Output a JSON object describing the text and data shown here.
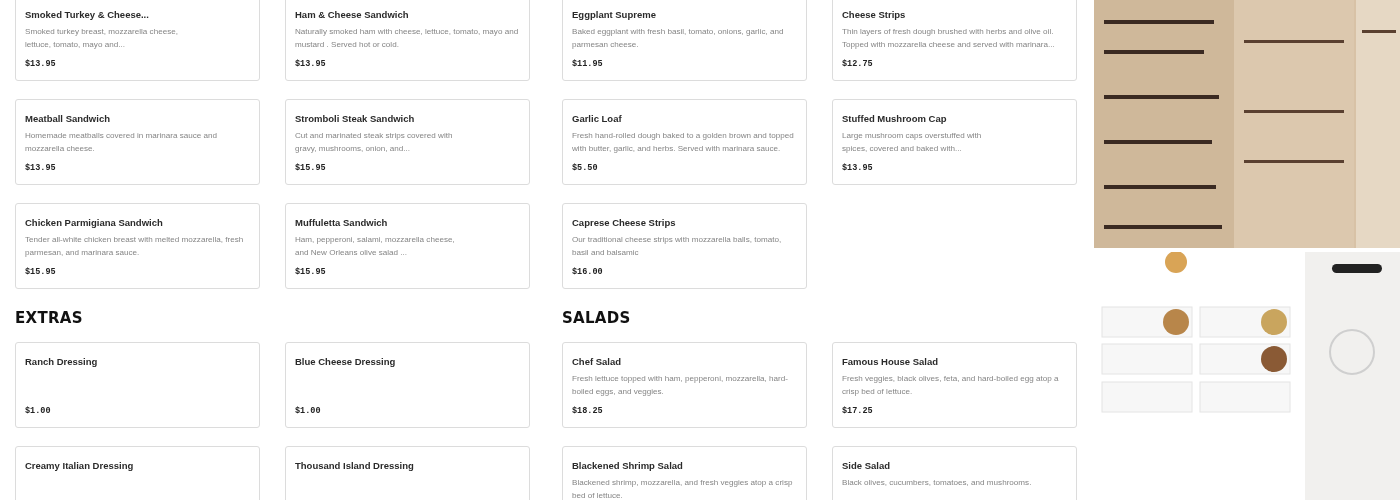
{
  "columns": [
    {
      "sections": [
        {
          "items": [
            {
              "name": "Smoked Turkey & Cheese...",
              "description": "Smoked turkey breast, mozzarella cheese, lettuce, tomato, mayo and...",
              "price": "$13.95",
              "narrow": true
            },
            {
              "name": "Ham & Cheese Sandwich",
              "description": "Naturally smoked ham with cheese, lettuce, tomato, mayo and mustard . Served hot or cold.",
              "price": "$13.95"
            },
            {
              "name": "Meatball Sandwich",
              "description": "Homemade meatballs covered in marinara sauce and mozzarella cheese.",
              "price": "$13.95"
            },
            {
              "name": "Stromboli Steak Sandwich",
              "description": "Cut and marinated steak strips covered with gravy, mushrooms, onion, and...",
              "price": "$15.95",
              "narrow": true
            },
            {
              "name": "Chicken Parmigiana Sandwich",
              "description": "Tender all-white chicken breast with melted mozzarella, fresh parmesan, and marinara sauce.",
              "price": "$15.95"
            },
            {
              "name": "Muffuletta Sandwich",
              "description": "Ham, pepperoni, salami, mozzarella cheese, and New Orleans olive salad ...",
              "price": "$15.95",
              "narrow": true
            }
          ]
        },
        {
          "heading": "EXTRAS",
          "items": [
            {
              "name": "Ranch Dressing",
              "price": "$1.00"
            },
            {
              "name": "Blue Cheese Dressing",
              "price": "$1.00"
            },
            {
              "name": "Creamy Italian Dressing"
            },
            {
              "name": "Thousand Island Dressing"
            }
          ]
        }
      ]
    },
    {
      "sections": [
        {
          "items": [
            {
              "name": "Eggplant Supreme",
              "description": "Baked eggplant with fresh basil, tomato, onions, garlic, and parmesan cheese.",
              "price": "$11.95"
            },
            {
              "name": "Cheese Strips",
              "description": "Thin layers of fresh dough brushed with herbs and olive oil. Topped with mozzarella cheese and served with marinara...",
              "price": "$12.75"
            },
            {
              "name": "Garlic Loaf",
              "description": "Fresh hand-rolled dough baked to a golden brown and topped with butter, garlic, and herbs. Served with marinara sauce.",
              "price": "$5.50"
            },
            {
              "name": "Stuffed Mushroom Cap",
              "description": "Large mushroom caps overstuffed with spices, covered and baked with...",
              "price": "$13.95",
              "narrow": true
            },
            {
              "name": "Caprese Cheese Strips",
              "description": "Our traditional cheese strips with mozzarella balls, tomato, basil and balsamic",
              "price": "$16.00"
            }
          ]
        },
        {
          "heading": "SALADS",
          "items": [
            {
              "name": "Chef Salad",
              "description": "Fresh lettuce topped with ham, pepperoni, mozzarella, hard-boiled eggs, and veggies.",
              "price": "$18.25"
            },
            {
              "name": "Famous House Salad",
              "description": "Fresh veggies, black olives, feta, and hard-boiled egg atop a crisp bed of lettuce.",
              "price": "$17.25"
            },
            {
              "name": "Blackened Shrimp Salad",
              "description": "Blackened shrimp, mozzarella, and fresh veggies atop a crisp bed of lettuce."
            },
            {
              "name": "Side Salad",
              "description": "Black olives, cucumbers, tomatoes, and mushrooms."
            }
          ]
        }
      ]
    }
  ]
}
